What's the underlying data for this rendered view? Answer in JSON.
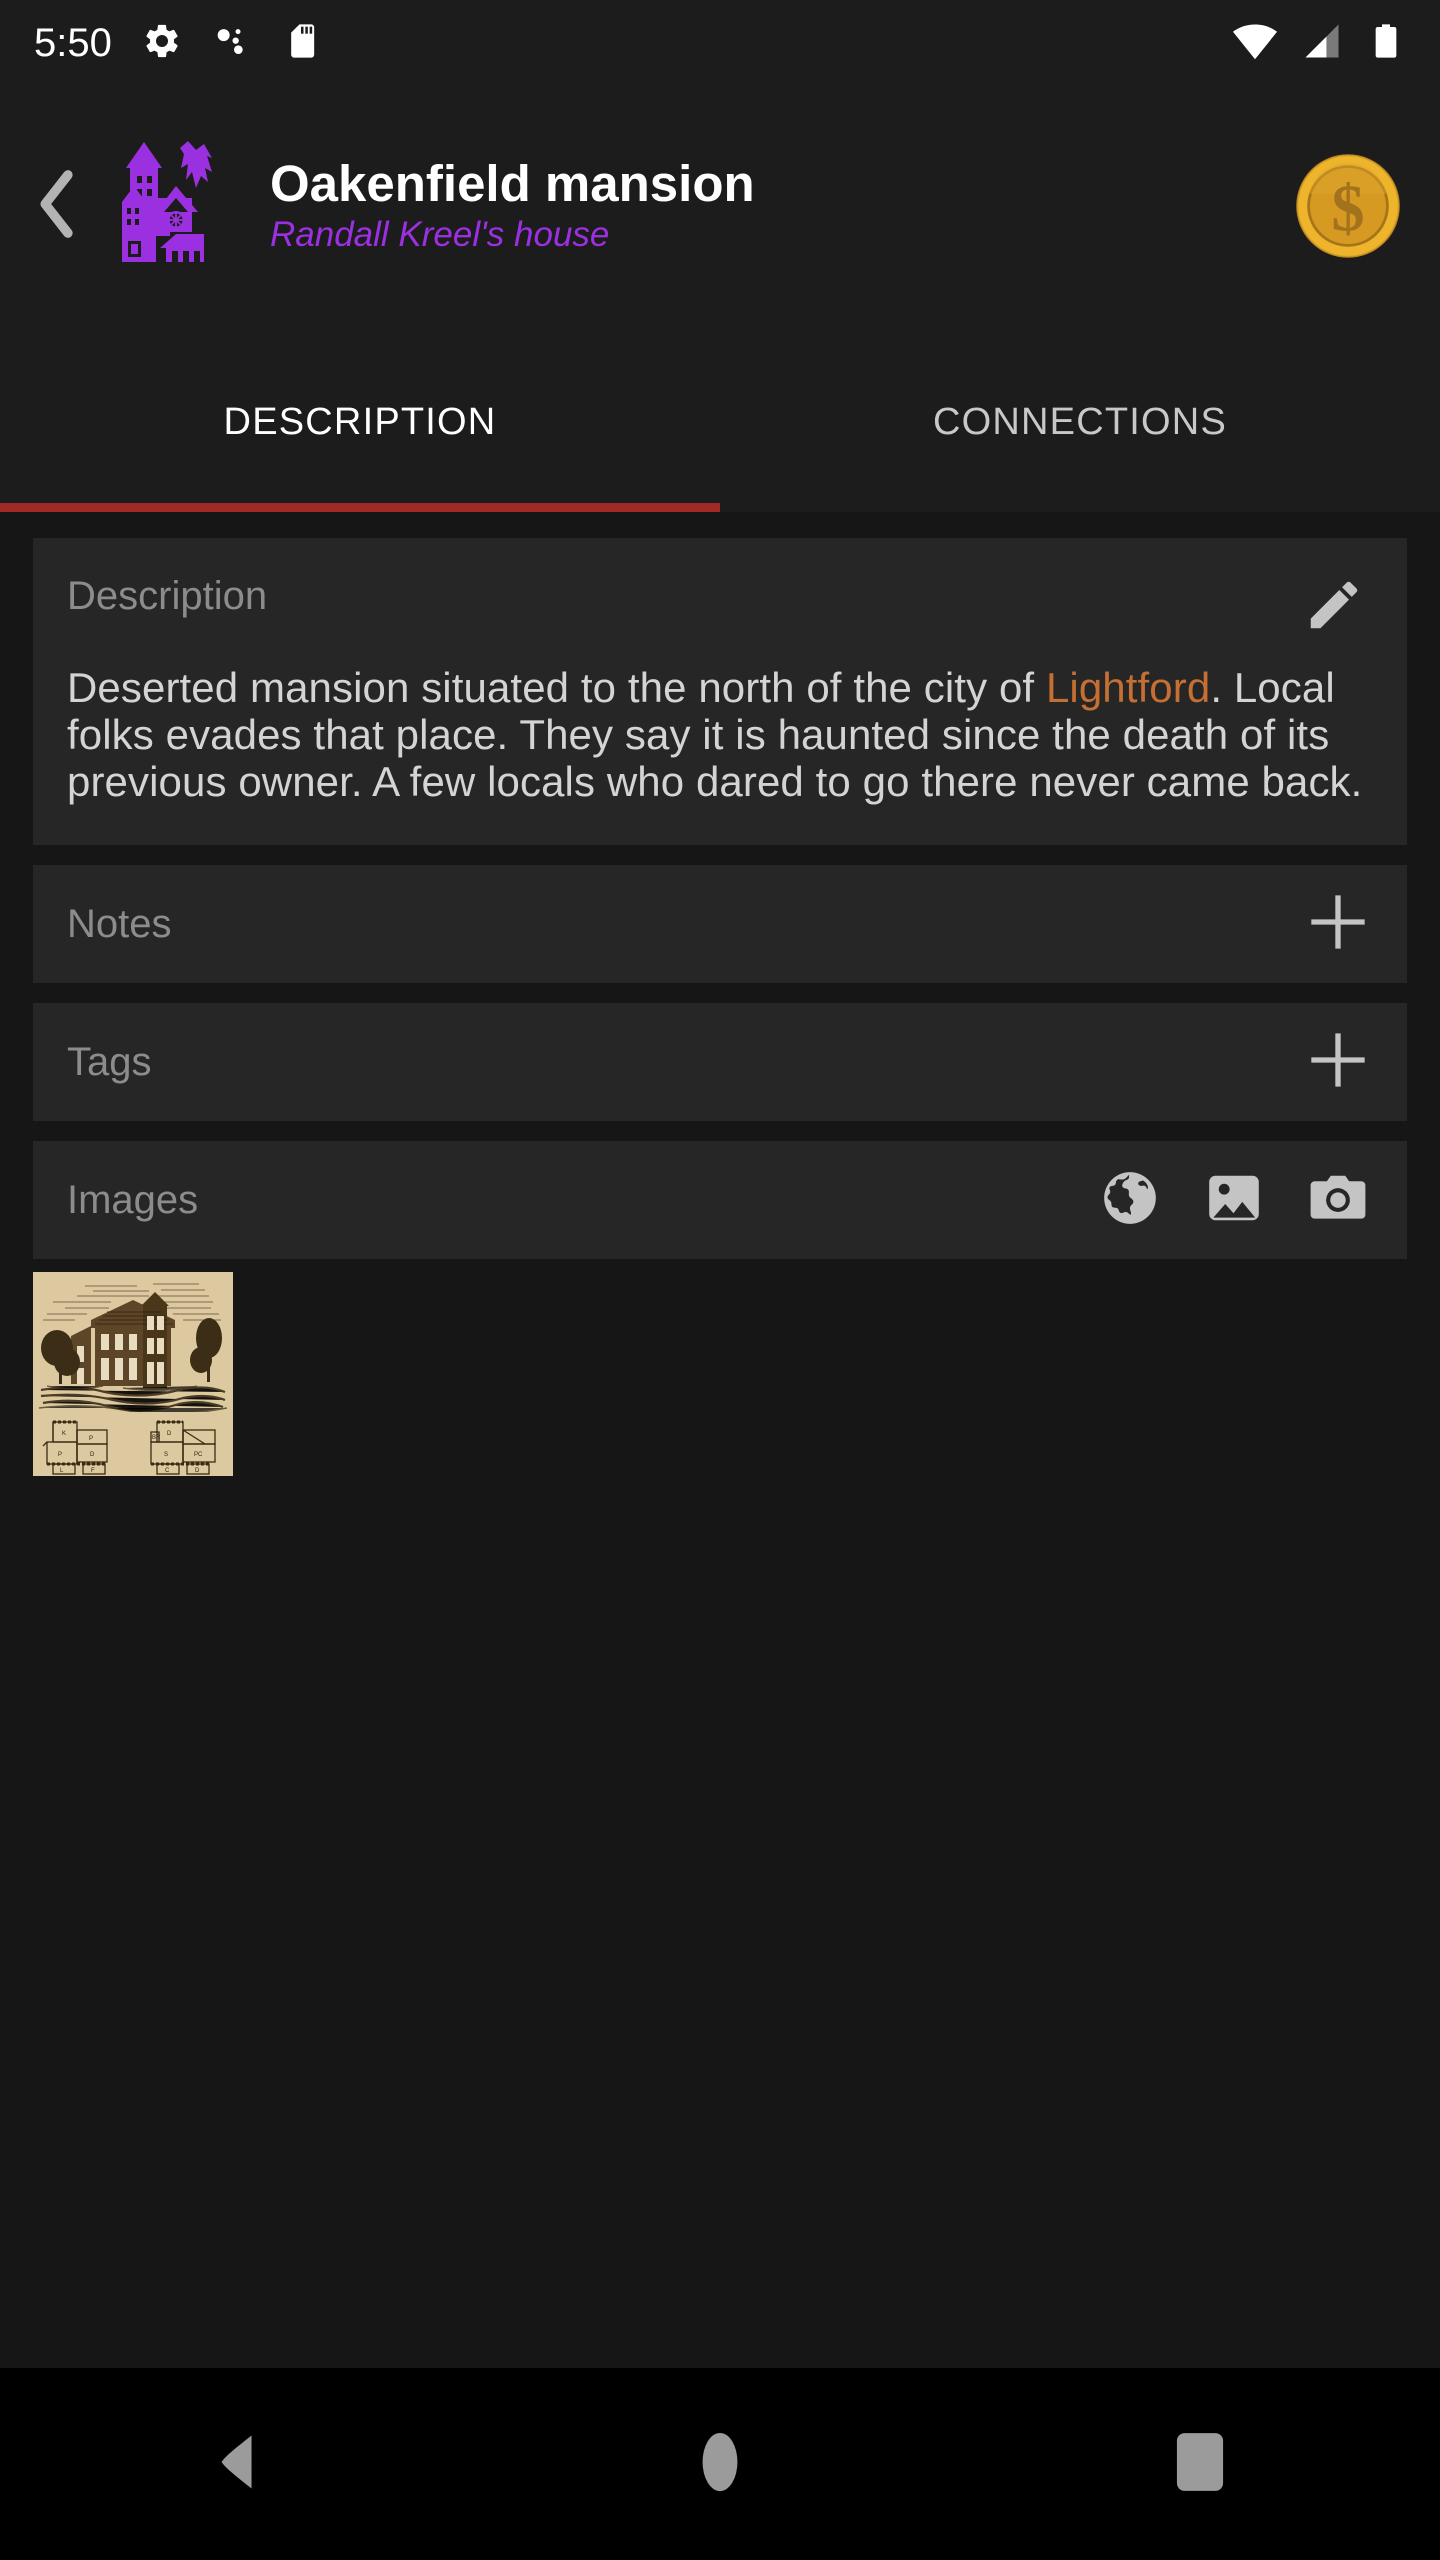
{
  "status_bar": {
    "time": "5:50",
    "left_icons": [
      "gear-icon",
      "bubbles-icon",
      "sd-card-icon"
    ],
    "right_icons": [
      "wifi-icon",
      "cell-signal-icon",
      "battery-icon"
    ]
  },
  "app_bar": {
    "back_icon": "chevron-left-icon",
    "entity_icon": "haunted-mansion-icon",
    "title": "Oakenfield mansion",
    "subtitle": "Randall Kreel's house",
    "currency_icon": "gold-coin-dollar-icon"
  },
  "tabs": [
    {
      "label": "DESCRIPTION",
      "active": true
    },
    {
      "label": "CONNECTIONS",
      "active": false
    }
  ],
  "sections": {
    "description": {
      "title": "Description",
      "edit_icon": "pencil-icon",
      "text_before_link": "Deserted mansion situated to the north of the city of ",
      "link_text": "Lightford",
      "text_after_link": ". Local folks evades that place. They say it is haunted since the death of its previous owner. A few locals who dared to go there never came back."
    },
    "notes": {
      "title": "Notes",
      "add_icon": "plus-icon"
    },
    "tags": {
      "title": "Tags",
      "add_icon": "plus-icon"
    },
    "images": {
      "title": "Images",
      "actions": [
        "globe-icon",
        "gallery-icon",
        "camera-icon"
      ],
      "thumbnails": [
        {
          "name": "mansion-engraving-thumbnail"
        }
      ]
    }
  },
  "nav_bar": {
    "back": "back-triangle-icon",
    "home": "home-circle-icon",
    "recents": "recents-square-icon"
  },
  "colors": {
    "accent_purple": "#9b30e0",
    "tab_indicator_red": "#9f2a26",
    "link_orange": "#c57032",
    "card_bg": "#262626",
    "page_bg": "#161616",
    "bar_bg": "#1c1c1c"
  }
}
